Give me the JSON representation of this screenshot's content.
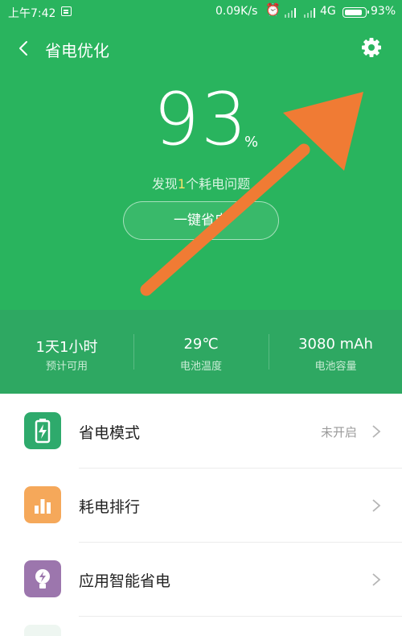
{
  "status_bar": {
    "time": "上午7:42",
    "speed": "0.09K/s",
    "network": "4G",
    "battery_percent": "93%",
    "battery_level": 0.93
  },
  "header": {
    "title": "省电优化"
  },
  "battery": {
    "level": "93",
    "unit": "%",
    "issues_prefix": "发现",
    "issues_count": "1",
    "issues_suffix": "个耗电问题",
    "button_label": "一键省电"
  },
  "stats": [
    {
      "value": "1天1小时",
      "label": "预计可用"
    },
    {
      "value": "29℃",
      "label": "电池温度"
    },
    {
      "value": "3080 mAh",
      "label": "电池容量"
    }
  ],
  "menu": [
    {
      "label": "省电模式",
      "value": "未开启",
      "icon": "battery-bolt-icon",
      "color": "#2eaa6c"
    },
    {
      "label": "耗电排行",
      "value": "",
      "icon": "bar-chart-icon",
      "color": "#f5a85a"
    },
    {
      "label": "应用智能省电",
      "value": "",
      "icon": "bulb-bolt-icon",
      "color": "#9c76ad"
    }
  ],
  "colors": {
    "header_green": "#29b45e",
    "stats_green": "#2ea862",
    "arrow": "#f07b34",
    "highlight": "#f7e36b"
  }
}
